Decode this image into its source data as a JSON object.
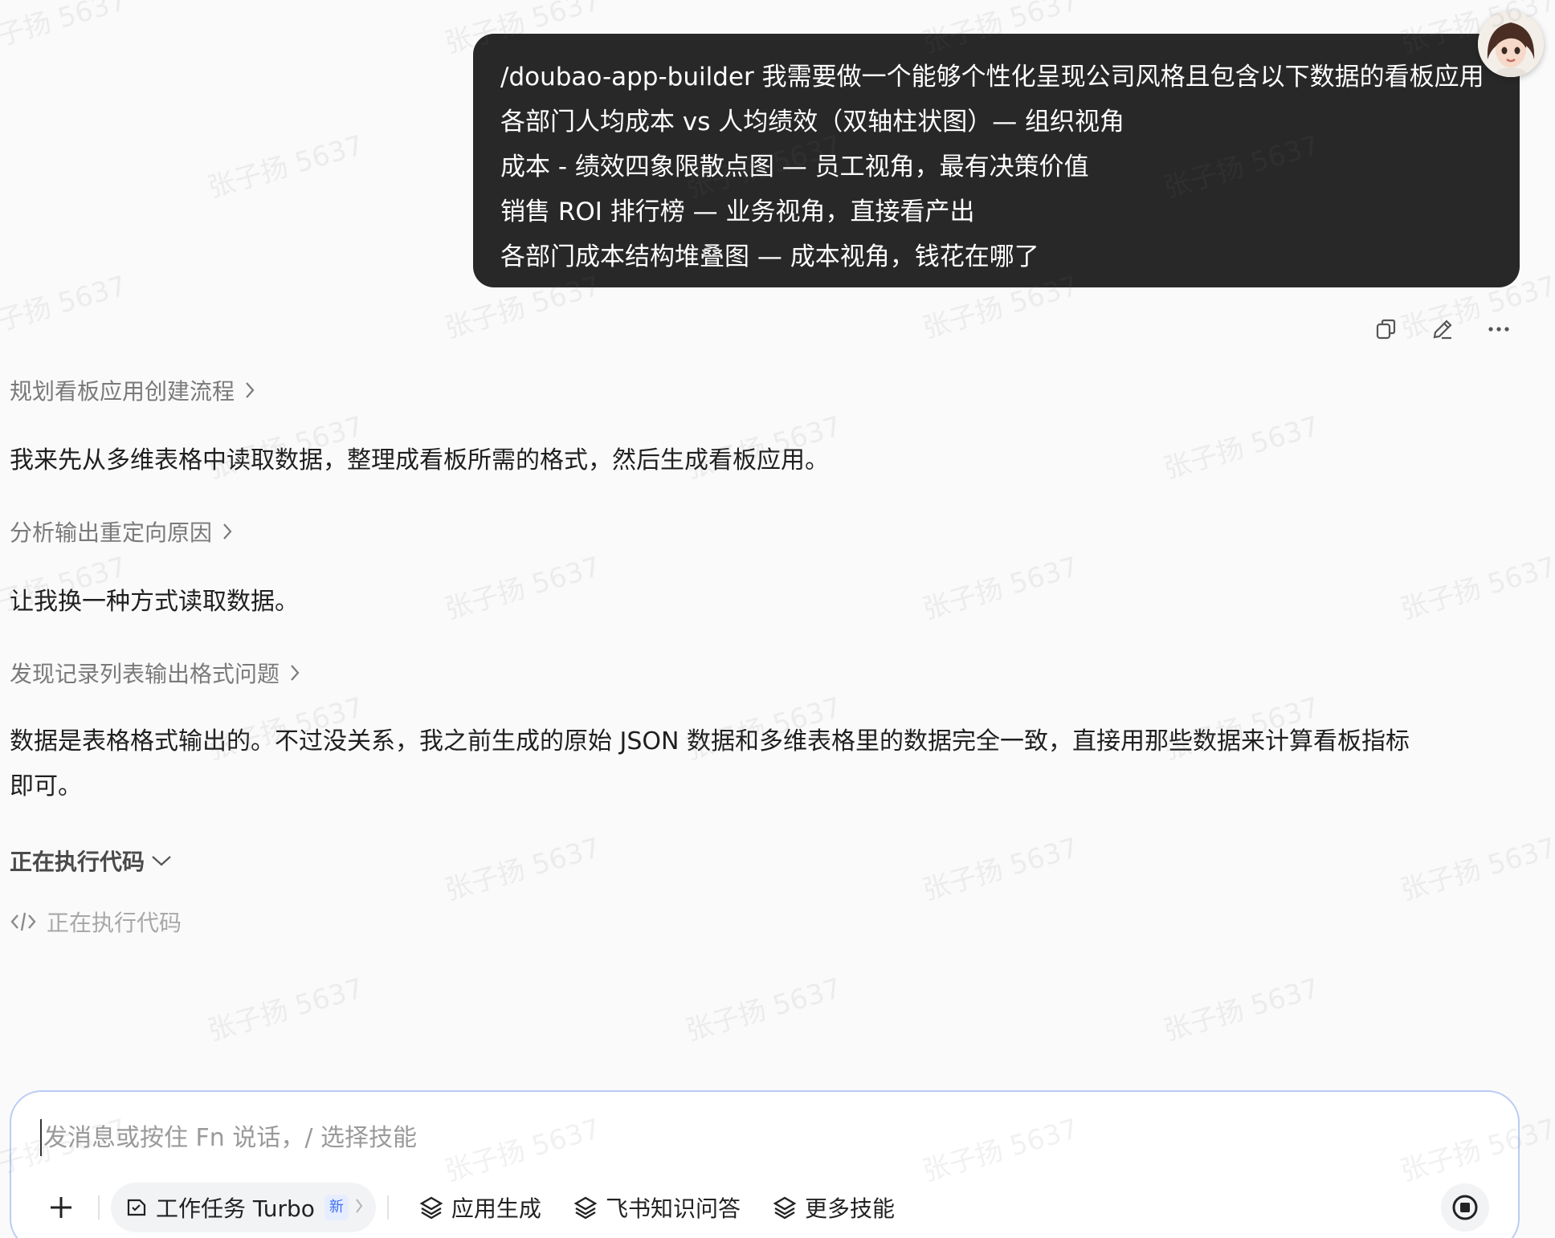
{
  "user_message": {
    "lines": [
      "/doubao-app-builder 我需要做一个能够个性化呈现公司风格且包含以下数据的看板应用",
      "各部门人均成本 vs 人均绩效（双轴柱状图）— 组织视角",
      "成本 - 绩效四象限散点图 — 员工视角，最有决策价值",
      "销售 ROI 排行榜 — 业务视角，直接看产出",
      "各部门成本结构堆叠图 — 成本视角，钱花在哪了"
    ]
  },
  "assistant": {
    "step1": "规划看板应用创建流程",
    "para1": "我来先从多维表格中读取数据，整理成看板所需的格式，然后生成看板应用。",
    "step2": "分析输出重定向原因",
    "para2": "让我换一种方式读取数据。",
    "step3": "发现记录列表输出格式问题",
    "para3_line1": "数据是表格格式输出的。不过没关系，我之前生成的原始 JSON 数据和多维表格里的数据完全一致，直接用那些数据来计算看板指标",
    "para3_line2": "即可。",
    "exec_title": "正在执行代码",
    "exec_status": "正在执行代码"
  },
  "composer": {
    "placeholder": "发消息或按住 Fn 说话，/ 选择技能",
    "turbo_label": "工作任务 Turbo",
    "turbo_badge": "新",
    "tool1": "应用生成",
    "tool2": "飞书知识问答",
    "tool3": "更多技能"
  },
  "watermark": "张子扬 5637",
  "icons": [
    "copy-icon",
    "edit-icon",
    "more-icon",
    "chevron-right-icon",
    "chevron-down-icon",
    "code-icon",
    "plus-icon",
    "task-icon",
    "skill-icon",
    "stop-icon"
  ],
  "colors": {
    "bubble": "#282828",
    "accent_border": "#b9ccf5",
    "badge": "#3d6ff0"
  }
}
